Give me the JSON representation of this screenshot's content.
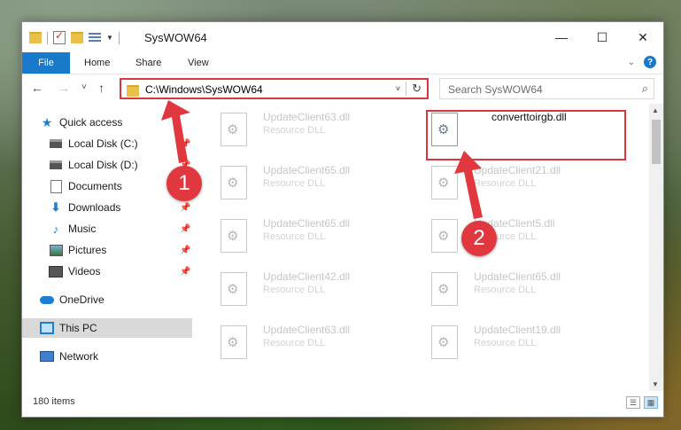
{
  "window": {
    "title": "SysWOW64"
  },
  "window_controls": {
    "minimize": "—",
    "maximize": "☐",
    "close": "✕"
  },
  "ribbon": {
    "tabs": [
      "File",
      "Home",
      "Share",
      "View"
    ],
    "collapse_icon": "chevron-down-icon",
    "help": "?"
  },
  "nav": {
    "back": "←",
    "forward": "→",
    "recent": "˅",
    "up": "↑"
  },
  "address": {
    "path": "C:\\Windows\\SysWOW64",
    "dropdown": "˅",
    "refresh": "↻"
  },
  "search": {
    "placeholder": "Search SysWOW64",
    "icon": "⌕"
  },
  "sidebar": {
    "items": [
      {
        "label": "Quick access",
        "icon": "star-icon",
        "pinned": false,
        "selected": false
      },
      {
        "label": "Local Disk (C:)",
        "icon": "drive-icon",
        "pinned": true,
        "selected": false
      },
      {
        "label": "Local Disk (D:)",
        "icon": "drive-icon",
        "pinned": true,
        "selected": false
      },
      {
        "label": "Documents",
        "icon": "document-icon",
        "pinned": true,
        "selected": false
      },
      {
        "label": "Downloads",
        "icon": "download-icon",
        "pinned": true,
        "selected": false
      },
      {
        "label": "Music",
        "icon": "music-icon",
        "pinned": true,
        "selected": false
      },
      {
        "label": "Pictures",
        "icon": "pictures-icon",
        "pinned": true,
        "selected": false
      },
      {
        "label": "Videos",
        "icon": "videos-icon",
        "pinned": true,
        "selected": false
      },
      {
        "label": "OneDrive",
        "icon": "cloud-icon",
        "pinned": false,
        "selected": false
      },
      {
        "label": "This PC",
        "icon": "computer-icon",
        "pinned": false,
        "selected": true
      },
      {
        "label": "Network",
        "icon": "network-icon",
        "pinned": false,
        "selected": false
      }
    ],
    "pin_glyph": "📌"
  },
  "files": [
    {
      "name": "UpdateClient63.dll",
      "type": "Resource DLL",
      "active": false
    },
    {
      "name": "converttoirgb.dll",
      "type": "",
      "active": true
    },
    {
      "name": "UpdateClient65.dll",
      "type": "Resource DLL",
      "active": false
    },
    {
      "name": "UpdateClient21.dll",
      "type": "Resource DLL",
      "active": false
    },
    {
      "name": "UpdateClient65.dll",
      "type": "Resource DLL",
      "active": false
    },
    {
      "name": "UpdateClient5.dll",
      "type": "Resource DLL",
      "active": false
    },
    {
      "name": "UpdateClient42.dll",
      "type": "Resource DLL",
      "active": false
    },
    {
      "name": "UpdateClient65.dll",
      "type": "Resource DLL",
      "active": false
    },
    {
      "name": "UpdateClient63.dll",
      "type": "Resource DLL",
      "active": false
    },
    {
      "name": "UpdateClient19.dll",
      "type": "Resource DLL",
      "active": false
    }
  ],
  "status": {
    "item_count": "180 items"
  },
  "annotations": [
    {
      "number": "1"
    },
    {
      "number": "2"
    }
  ],
  "colors": {
    "accent": "#1979ca",
    "highlight": "#d9363e",
    "badge": "#e0383e"
  }
}
